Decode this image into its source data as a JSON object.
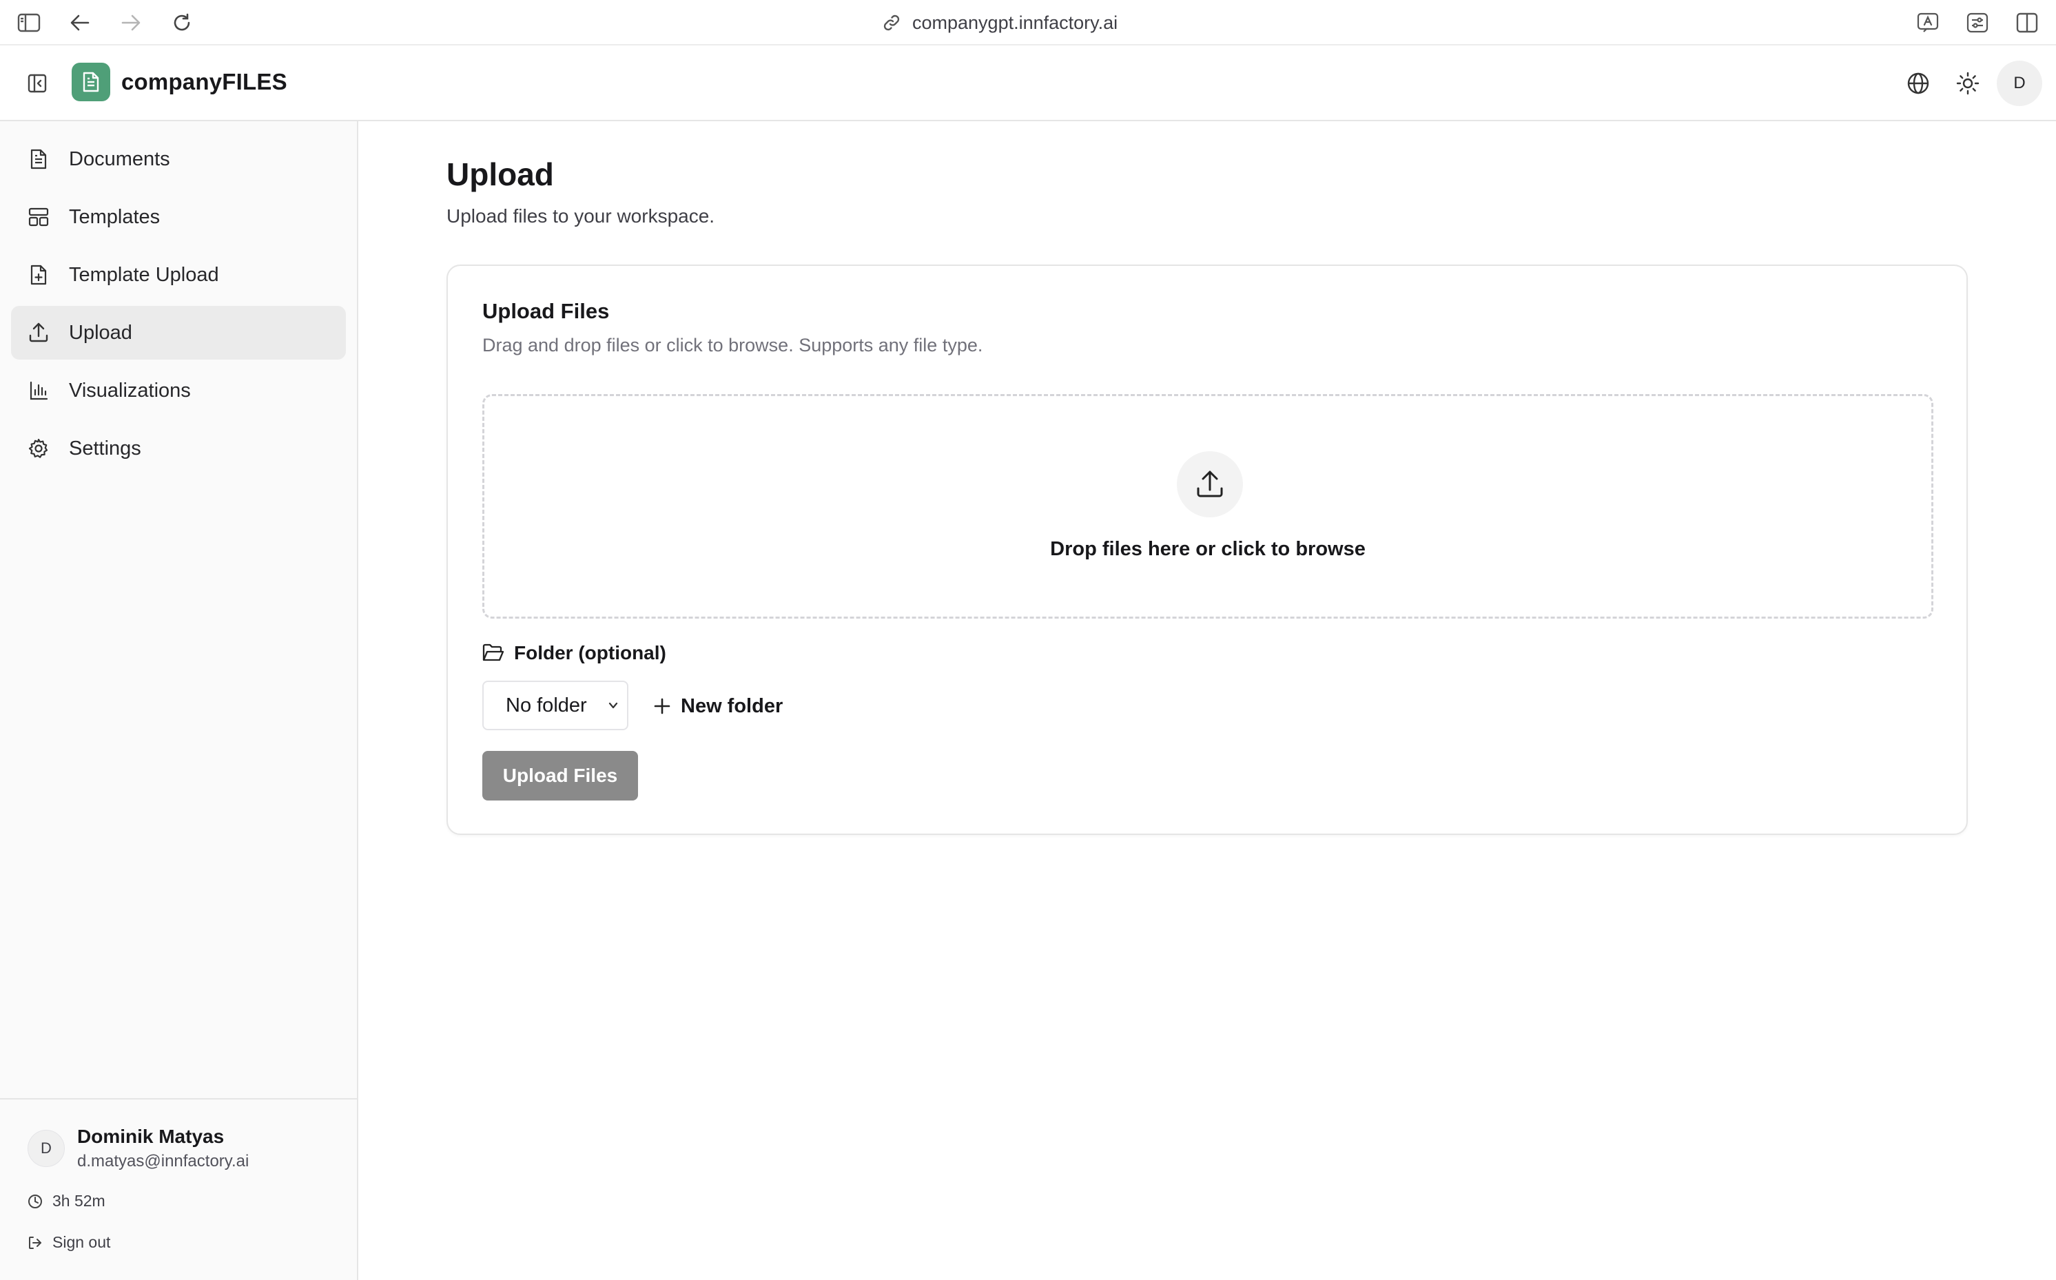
{
  "browser": {
    "url": "companygpt.innfactory.ai"
  },
  "header": {
    "brand": "companyFILES",
    "avatar_initial": "D"
  },
  "sidebar": {
    "items": [
      {
        "label": "Documents",
        "icon": "file-text-icon",
        "active": false
      },
      {
        "label": "Templates",
        "icon": "layout-template-icon",
        "active": false
      },
      {
        "label": "Template Upload",
        "icon": "file-plus-icon",
        "active": false
      },
      {
        "label": "Upload",
        "icon": "upload-icon",
        "active": true
      },
      {
        "label": "Visualizations",
        "icon": "bar-chart-icon",
        "active": false
      },
      {
        "label": "Settings",
        "icon": "gear-icon",
        "active": false
      }
    ],
    "user": {
      "initial": "D",
      "name": "Dominik Matyas",
      "email": "d.matyas@innfactory.ai",
      "session_time": "3h 52m",
      "sign_out_label": "Sign out"
    }
  },
  "main": {
    "title": "Upload",
    "subtitle": "Upload files to your workspace.",
    "card": {
      "title": "Upload Files",
      "description": "Drag and drop files or click to browse. Supports any file type.",
      "dropzone_text": "Drop files here or click to browse",
      "folder_label": "Folder (optional)",
      "folder_select_value": "No folder",
      "new_folder_label": "New folder",
      "upload_button_label": "Upload Files"
    }
  },
  "colors": {
    "brand_green": "#4f9f78",
    "active_nav_bg": "#ebebeb",
    "disabled_button": "#8a8a8a"
  }
}
